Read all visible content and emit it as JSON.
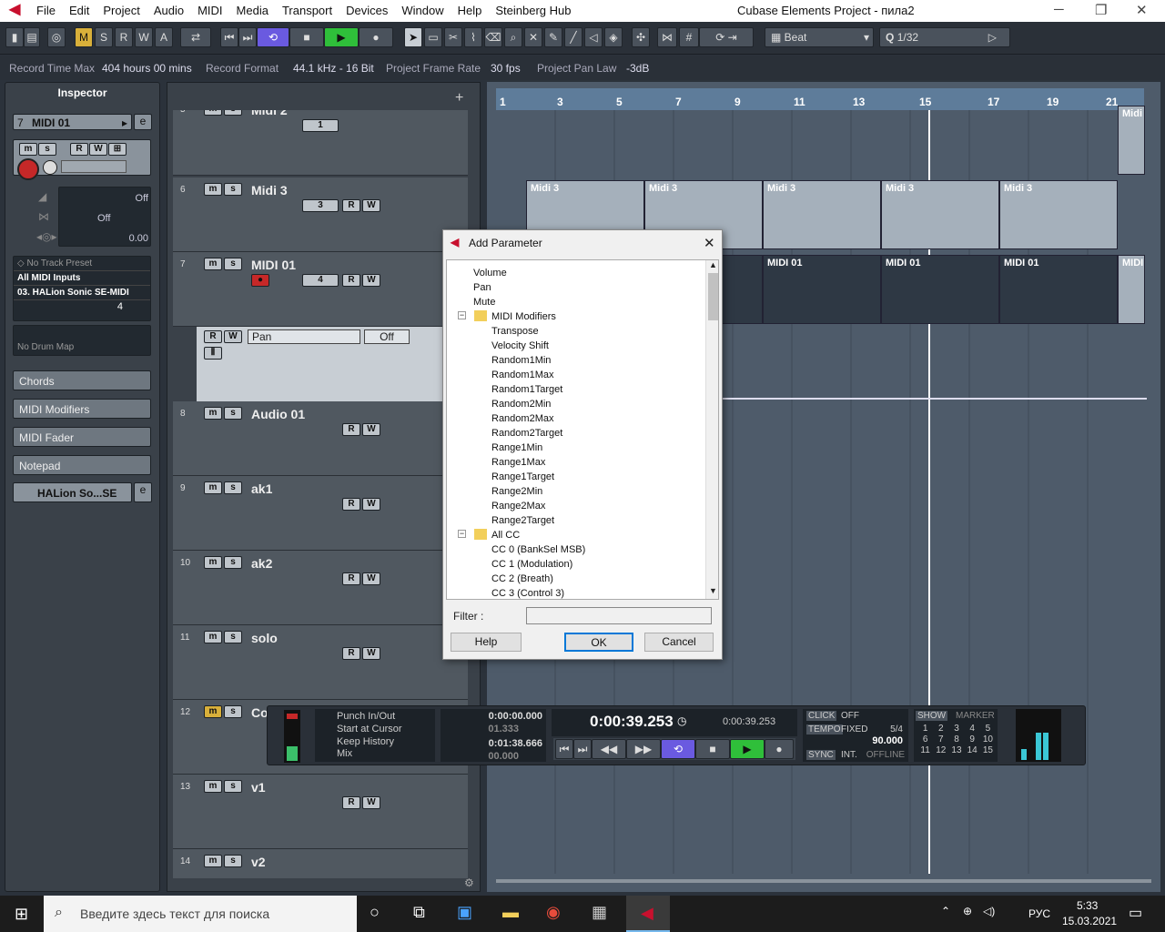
{
  "window": {
    "title": "Cubase Elements Project - пила2",
    "menu": [
      "File",
      "Edit",
      "Project",
      "Audio",
      "MIDI",
      "Media",
      "Transport",
      "Devices",
      "Window",
      "Help",
      "Steinberg Hub"
    ]
  },
  "toolbar": {
    "mode_buttons": [
      "M",
      "S",
      "R",
      "W",
      "A"
    ],
    "grid_type": "Beat",
    "quantize_label": "Q",
    "quantize_value": "1/32"
  },
  "status": {
    "record_time_label": "Record Time Max",
    "record_time_value": "404 hours 00 mins",
    "record_format_label": "Record Format",
    "record_format_value": "44.1 kHz - 16 Bit",
    "frame_rate_label": "Project Frame Rate",
    "frame_rate_value": "30 fps",
    "pan_law_label": "Project Pan Law",
    "pan_law_value": "-3dB"
  },
  "inspector": {
    "title": "Inspector",
    "track_number": "7",
    "track_name": "MIDI 01",
    "volume_off": "Off",
    "pan_off": "Off",
    "delay_value": "0.00",
    "preset": "No Track Preset",
    "input": "All MIDI Inputs",
    "output": "03. HALion Sonic SE-MIDI",
    "channel": "4",
    "drum_map": "No Drum Map",
    "sections": [
      "Chords",
      "MIDI Modifiers",
      "MIDI Fader",
      "Notepad"
    ],
    "instrument": "HALion So...SE"
  },
  "tracks": [
    {
      "num": "5",
      "name": "Midi 2",
      "channel": "1"
    },
    {
      "num": "6",
      "name": "Midi 3",
      "channel": "3"
    },
    {
      "num": "7",
      "name": "MIDI 01",
      "channel": "4"
    },
    {
      "num": "8",
      "name": "Audio 01"
    },
    {
      "num": "9",
      "name": "ak1"
    },
    {
      "num": "10",
      "name": "ak2"
    },
    {
      "num": "11",
      "name": "solo"
    },
    {
      "num": "12",
      "name": "Co"
    },
    {
      "num": "13",
      "name": "v1"
    },
    {
      "num": "14",
      "name": "v2"
    }
  ],
  "automation_lane": {
    "param": "Pan",
    "value": "Off"
  },
  "ruler": {
    "bars": [
      "1",
      "3",
      "5",
      "7",
      "9",
      "11",
      "13",
      "15",
      "17",
      "19",
      "21"
    ]
  },
  "parts": {
    "midi3": [
      "Midi 3",
      "Midi 3",
      "Midi 3",
      "Midi 3",
      "Midi 3"
    ],
    "midi01": [
      "MIDI 01",
      "MIDI 01",
      "MIDI 01",
      "MIDI"
    ],
    "midi2": "Midi"
  },
  "dialog": {
    "title": "Add Parameter",
    "items": [
      "Volume",
      "Pan",
      "Mute",
      "MIDI Modifiers",
      "Transpose",
      "Velocity Shift",
      "Random1Min",
      "Random1Max",
      "Random1Target",
      "Random2Min",
      "Random2Max",
      "Random2Target",
      "Range1Min",
      "Range1Max",
      "Range1Target",
      "Range2Min",
      "Range2Max",
      "Range2Target",
      "All CC",
      "CC 0  (BankSel MSB)",
      "CC 1  (Modulation)",
      "CC 2  (Breath)",
      "CC 3  (Control 3)"
    ],
    "filter_label": "Filter :",
    "help": "Help",
    "ok": "OK",
    "cancel": "Cancel"
  },
  "transport": {
    "punch": "Punch In/Out",
    "start_cursor": "Start at Cursor",
    "keep_history": "Keep History",
    "mix": "Mix",
    "left_locator": "0:00:00.000",
    "left_sub": "01.333",
    "right_locator": "0:01:38.666",
    "right_sub": "00.000",
    "primary_time": "0:00:39.253",
    "secondary_time": "0:00:39.253",
    "click_label": "CLICK",
    "click_value": "OFF",
    "tempo_label": "TEMPO",
    "tempo_mode": "FIXED",
    "signature": "5/4",
    "tempo": "90.000",
    "sync_label": "SYNC",
    "sync_mode": "INT.",
    "sync_status": "OFFLINE",
    "show_label": "SHOW",
    "marker_label": "MARKER",
    "markers": [
      "1",
      "2",
      "3",
      "4",
      "5",
      "6",
      "7",
      "8",
      "9",
      "10",
      "11",
      "12",
      "13",
      "14",
      "15"
    ]
  },
  "taskbar": {
    "search_placeholder": "Введите здесь текст для поиска",
    "lang": "РУС",
    "time": "5:33",
    "date": "15.03.2021"
  }
}
